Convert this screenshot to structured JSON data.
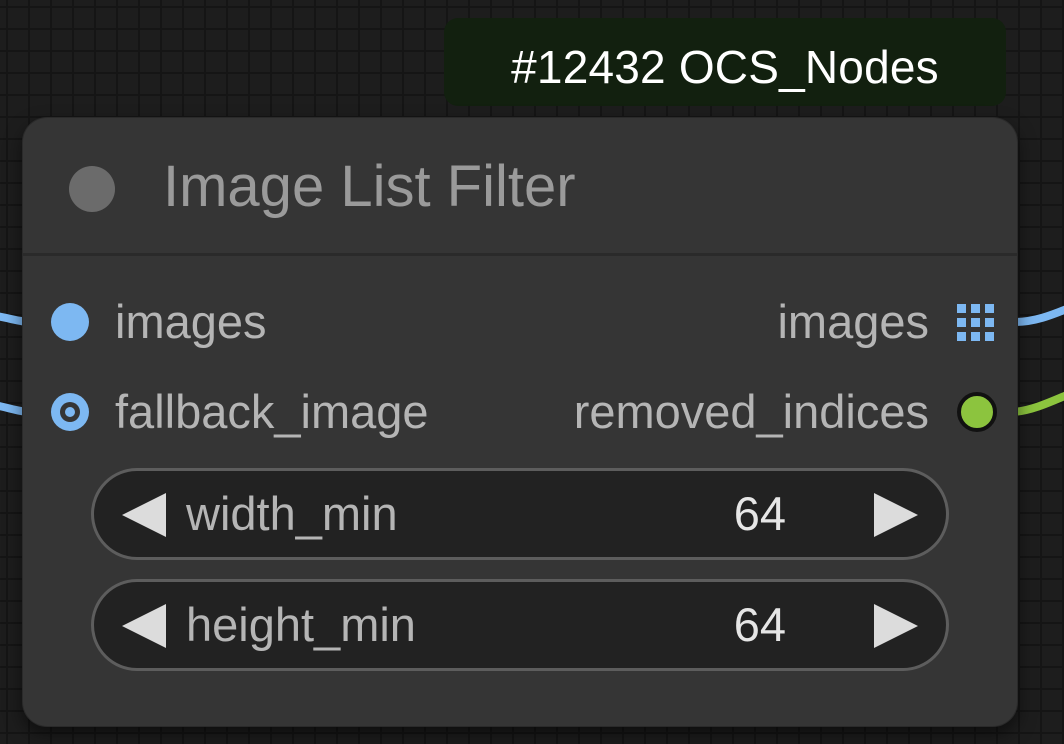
{
  "badge": {
    "text": "#12432 OCS_Nodes"
  },
  "node": {
    "title": "Image List Filter",
    "inputs": [
      {
        "label": "images",
        "type": "IMAGE",
        "optional": false
      },
      {
        "label": "fallback_image",
        "type": "IMAGE",
        "optional": true
      }
    ],
    "outputs": [
      {
        "label": "images",
        "icon": "list-grid-icon",
        "type": "IMAGE"
      },
      {
        "label": "removed_indices",
        "type": "INT"
      }
    ],
    "widgets": [
      {
        "name": "width_min",
        "value": "64"
      },
      {
        "name": "height_min",
        "value": "64"
      }
    ]
  },
  "colors": {
    "image_link": "#7db8f2",
    "int_link": "#8cc43e",
    "badge_bg": "#12200f",
    "node_bg": "#353535",
    "title_text": "#9a9a9a"
  }
}
